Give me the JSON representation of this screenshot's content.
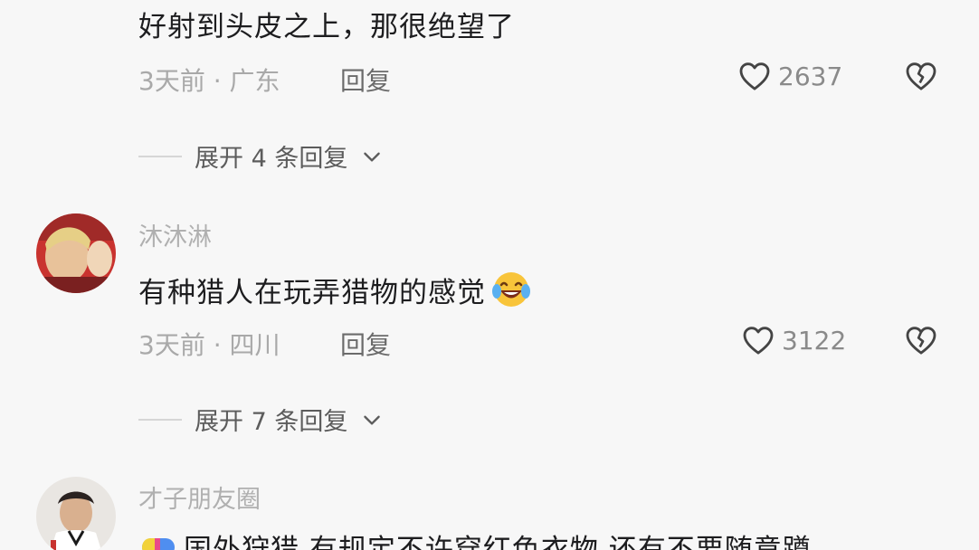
{
  "comments": [
    {
      "text": "好射到头皮之上，那很绝望了",
      "meta": "3天前 · 广东",
      "reply_label": "回复",
      "likes": "2637",
      "expand_label": "展开 4 条回复"
    },
    {
      "username": "沐沐淋",
      "text": "有种猎人在玩弄猎物的感觉",
      "emoji": "laughing-tears-emoji",
      "meta": "3天前 · 四川",
      "reply_label": "回复",
      "likes": "3122",
      "expand_label": "展开 7 条回复"
    },
    {
      "username": "才子朋友圈",
      "text": "国外狩猎 有规定不许穿红色衣物  还有不要随意蹲"
    }
  ],
  "icons": {
    "like": "heart-outline-icon",
    "dislike": "broken-heart-icon",
    "expand": "chevron-down-icon"
  },
  "colors": {
    "background": "#f7f7f7",
    "text": "#1d1d1f",
    "meta": "#a9a9a9",
    "username": "#b0b0b0"
  }
}
